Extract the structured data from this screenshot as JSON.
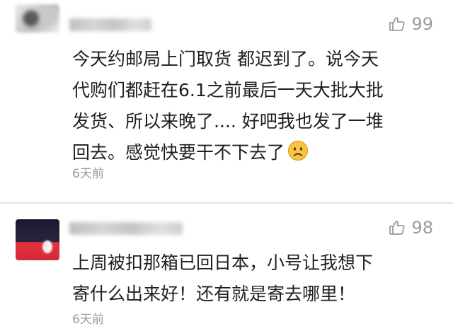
{
  "comments": [
    {
      "likes": "99",
      "text_lines": [
        "今天约邮局上门取货 都迟到了。说今天",
        "代购们都赶在6.1之前最后一天大批大批",
        "发货、所以来晚了.... 好吧我也发了一堆",
        "回去。感觉快要干不下去了"
      ],
      "emoji": "sad-face",
      "time": "6天前"
    },
    {
      "likes": "98",
      "text_lines": [
        "上周被扣那箱已回日本，小号让我想下",
        "寄什么出来好！还有就是寄去哪里！"
      ],
      "time": "6天前"
    }
  ],
  "colors": {
    "meta_gray": "#9a9a9a",
    "text": "#1f1f1f",
    "emoji_yellow": "#f7c543"
  }
}
